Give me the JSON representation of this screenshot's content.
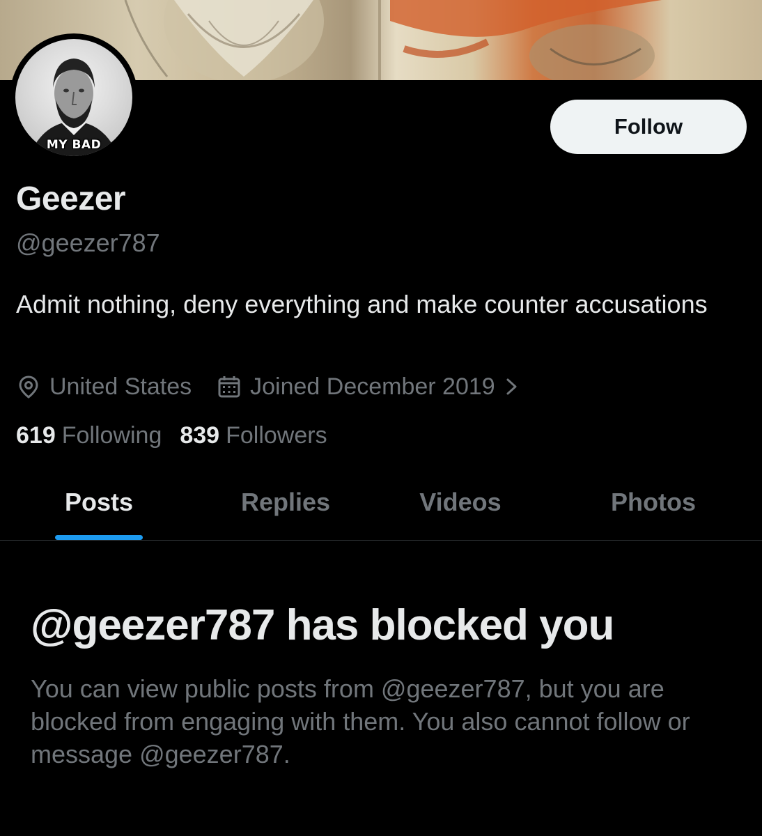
{
  "profile": {
    "avatar_caption": "MY BAD",
    "display_name": "Geezer",
    "handle": "@geezer787",
    "bio": "Admit nothing, deny everything and make counter accusations",
    "location": "United States",
    "joined": "Joined December 2019",
    "following_count": "619",
    "following_label": "Following",
    "followers_count": "839",
    "followers_label": "Followers"
  },
  "actions": {
    "follow_label": "Follow"
  },
  "tabs": [
    {
      "label": "Posts",
      "active": true
    },
    {
      "label": "Replies",
      "active": false
    },
    {
      "label": "Videos",
      "active": false
    },
    {
      "label": "Photos",
      "active": false
    }
  ],
  "blocked": {
    "title": "@geezer787 has blocked you",
    "message": "You can view public posts from @geezer787, but you are blocked from engaging with them. You also cannot follow or message @geezer787."
  },
  "icons": {
    "location": "location-pin-icon",
    "calendar": "calendar-icon",
    "chevron": "chevron-right-icon"
  },
  "colors": {
    "background": "#000000",
    "primary_text": "#e7e9ea",
    "secondary_text": "#71767b",
    "accent": "#1d9bf0",
    "follow_button_bg": "#eff3f4"
  }
}
